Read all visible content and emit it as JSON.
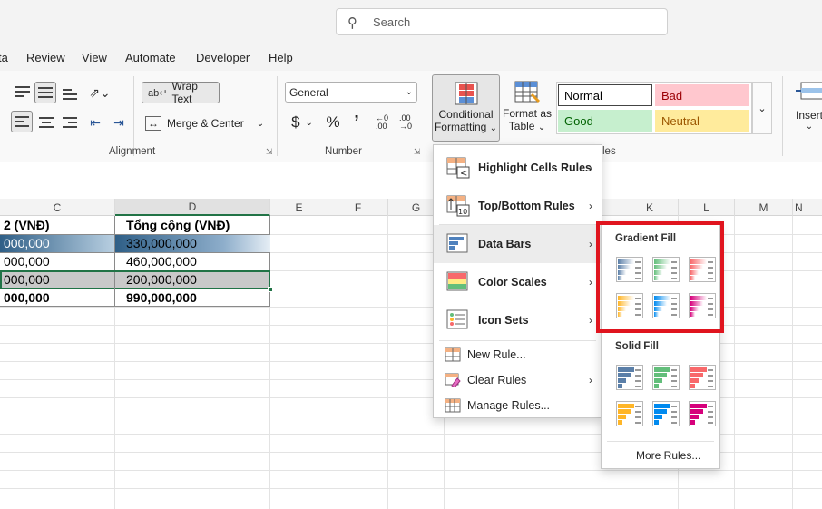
{
  "search": {
    "placeholder": "Search"
  },
  "menu_tabs": [
    "ta",
    "Review",
    "View",
    "Automate",
    "Developer",
    "Help"
  ],
  "ribbon": {
    "alignment": {
      "wrap_text": "Wrap Text",
      "merge_center": "Merge & Center",
      "label": "Alignment"
    },
    "number": {
      "format_value": "General",
      "currency_symbol": "$",
      "percent_symbol": "%",
      "comma_symbol": "̧",
      "label": "Number"
    },
    "conditional_formatting": {
      "line1": "Conditional",
      "line2": "Formatting"
    },
    "format_as_table": {
      "line1": "Format as",
      "line2": "Table"
    },
    "styles": {
      "normal": "Normal",
      "bad": "Bad",
      "good": "Good",
      "neutral": "Neutral",
      "label_partial": "les"
    },
    "insert": {
      "label": "Insert"
    }
  },
  "columns": [
    "C",
    "D",
    "E",
    "F",
    "G",
    "K",
    "L",
    "M",
    "N"
  ],
  "rows": [
    {
      "c": "2 (VNĐ)",
      "d": "Tổng cộng (VNĐ)",
      "bold": true
    },
    {
      "c": "000,000",
      "d": "330,000,000",
      "bold": false
    },
    {
      "c": "000,000",
      "d": "460,000,000",
      "bold": false
    },
    {
      "c": "000,000",
      "d": "200,000,000",
      "bold": false
    },
    {
      "c": "000,000",
      "d": "990,000,000",
      "bold": true
    }
  ],
  "cf_menu": {
    "highlight_cells_rules": "Highlight Cells Rules",
    "top_bottom_rules": "Top/Bottom Rules",
    "data_bars": "Data Bars",
    "color_scales": "Color Scales",
    "icon_sets": "Icon Sets",
    "new_rule": "New Rule...",
    "clear_rules": "Clear Rules",
    "manage_rules": "Manage Rules..."
  },
  "databar_submenu": {
    "gradient_fill": "Gradient Fill",
    "solid_fill": "Solid Fill",
    "more_rules": "More Rules...",
    "colors": [
      "#5b7fa8",
      "#63be7b",
      "#f8696b",
      "#ffb628",
      "#008aef",
      "#d6007b"
    ]
  },
  "highlight_color": "#e0141e"
}
